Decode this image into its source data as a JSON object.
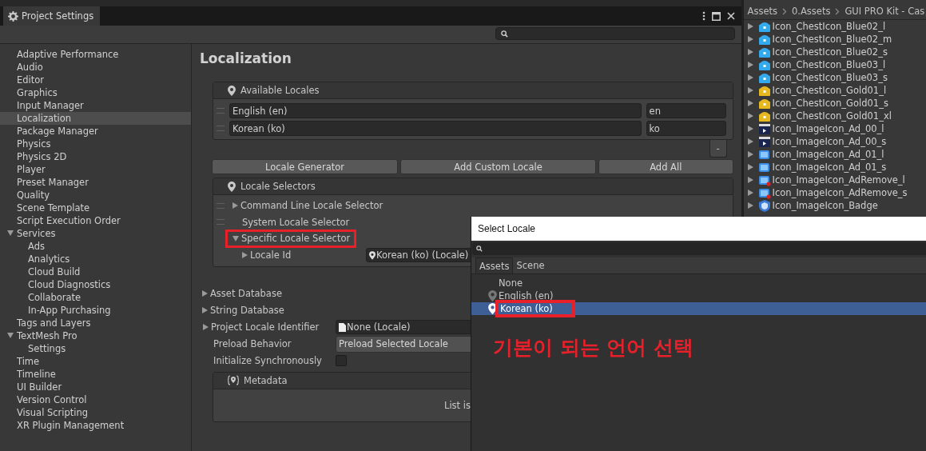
{
  "window": {
    "title": "Project Settings"
  },
  "sidebar": {
    "items": [
      {
        "label": "Adaptive Performance",
        "selected": false
      },
      {
        "label": "Audio",
        "selected": false
      },
      {
        "label": "Editor",
        "selected": false
      },
      {
        "label": "Graphics",
        "selected": false
      },
      {
        "label": "Input Manager",
        "selected": false
      },
      {
        "label": "Localization",
        "selected": true
      },
      {
        "label": "Package Manager",
        "selected": false
      },
      {
        "label": "Physics",
        "selected": false
      },
      {
        "label": "Physics 2D",
        "selected": false
      },
      {
        "label": "Player",
        "selected": false
      },
      {
        "label": "Preset Manager",
        "selected": false
      },
      {
        "label": "Quality",
        "selected": false
      },
      {
        "label": "Scene Template",
        "selected": false
      },
      {
        "label": "Script Execution Order",
        "selected": false
      },
      {
        "label": "Services",
        "selected": false,
        "expanded": true,
        "children": [
          {
            "label": "Ads",
            "selected": false
          },
          {
            "label": "Analytics",
            "selected": false
          },
          {
            "label": "Cloud Build",
            "selected": false
          },
          {
            "label": "Cloud Diagnostics",
            "selected": false
          },
          {
            "label": "Collaborate",
            "selected": false
          },
          {
            "label": "In-App Purchasing",
            "selected": false
          }
        ]
      },
      {
        "label": "Tags and Layers",
        "selected": false
      },
      {
        "label": "TextMesh Pro",
        "selected": false,
        "expanded": true,
        "children": [
          {
            "label": "Settings",
            "selected": false
          }
        ]
      },
      {
        "label": "Time",
        "selected": false
      },
      {
        "label": "Timeline",
        "selected": false
      },
      {
        "label": "UI Builder",
        "selected": false
      },
      {
        "label": "Version Control",
        "selected": false
      },
      {
        "label": "Visual Scripting",
        "selected": false
      },
      {
        "label": "XR Plugin Management",
        "selected": false
      }
    ]
  },
  "content": {
    "heading": "Localization",
    "available_locales": {
      "title": "Available Locales",
      "rows": [
        {
          "name": "English (en)",
          "code": "en"
        },
        {
          "name": "Korean (ko)",
          "code": "ko"
        }
      ],
      "remove_button": "-"
    },
    "buttons": [
      "Locale Generator",
      "Add Custom Locale",
      "Add All"
    ],
    "locale_selectors": {
      "title": "Locale Selectors",
      "items": [
        {
          "label": "Command Line Locale Selector",
          "kind": "foldout",
          "expanded": false,
          "highlighted": false
        },
        {
          "label": "System Locale Selector",
          "kind": "plain",
          "expanded": false,
          "highlighted": false
        },
        {
          "label": "Specific Locale Selector",
          "kind": "foldout",
          "expanded": true,
          "highlighted": true,
          "field": {
            "label": "Locale Id",
            "value": "Korean (ko) (Locale)"
          }
        }
      ]
    },
    "foldouts": [
      "Asset Database",
      "String Database"
    ],
    "project_locale_identifier": {
      "label": "Project Locale Identifier",
      "value": "None (Locale)"
    },
    "preload_behavior": {
      "label": "Preload Behavior",
      "value": "Preload Selected Locale"
    },
    "initialize_synchronously": {
      "label": "Initialize Synchronously",
      "checked": false
    },
    "metadata": {
      "title": "Metadata",
      "empty_text": "List is"
    }
  },
  "assets_panel": {
    "breadcrumb": [
      "Assets",
      "0.Assets",
      "GUI PRO Kit - Cas"
    ],
    "items": [
      {
        "name": "Icon_ChestIcon_Blue02_l",
        "kind": "chest",
        "color": "#33aaee"
      },
      {
        "name": "Icon_ChestIcon_Blue02_m",
        "kind": "chest",
        "color": "#33aaee"
      },
      {
        "name": "Icon_ChestIcon_Blue02_s",
        "kind": "chest",
        "color": "#33aaee"
      },
      {
        "name": "Icon_ChestIcon_Blue03_l",
        "kind": "chest",
        "color": "#33aaee"
      },
      {
        "name": "Icon_ChestIcon_Blue03_s",
        "kind": "chest",
        "color": "#33aaee"
      },
      {
        "name": "Icon_ChestIcon_Gold01_l",
        "kind": "chest",
        "color": "#e8b820"
      },
      {
        "name": "Icon_ChestIcon_Gold01_s",
        "kind": "chest",
        "color": "#e8b820"
      },
      {
        "name": "Icon_ChestIcon_Gold01_xl",
        "kind": "chest",
        "color": "#e8b820"
      },
      {
        "name": "Icon_ImageIcon_Ad_00_l",
        "kind": "clapper",
        "color": "#1a2550"
      },
      {
        "name": "Icon_ImageIcon_Ad_00_s",
        "kind": "clapper",
        "color": "#1a2550"
      },
      {
        "name": "Icon_ImageIcon_Ad_01_l",
        "kind": "screen",
        "color": "#3a8ee8"
      },
      {
        "name": "Icon_ImageIcon_Ad_01_s",
        "kind": "screen",
        "color": "#3a8ee8"
      },
      {
        "name": "Icon_ImageIcon_AdRemove_l",
        "kind": "screen-remove",
        "color": "#3a8ee8"
      },
      {
        "name": "Icon_ImageIcon_AdRemove_s",
        "kind": "screen-remove",
        "color": "#3a8ee8"
      },
      {
        "name": "Icon_ImageIcon_Badge",
        "kind": "badge",
        "color": "#3a7ad8"
      }
    ]
  },
  "select_locale_popup": {
    "title": "Select Locale",
    "tabs": [
      {
        "label": "Assets",
        "selected": true
      },
      {
        "label": "Scene",
        "selected": false
      }
    ],
    "items": [
      {
        "label": "None",
        "icon": false,
        "selected": false,
        "highlighted": false
      },
      {
        "label": "English (en)",
        "icon": true,
        "selected": false,
        "highlighted": false
      },
      {
        "label": "Korean (ko)",
        "icon": true,
        "selected": true,
        "highlighted": true
      }
    ]
  },
  "annotation": {
    "text": "기본이 되는 언어 선택"
  }
}
